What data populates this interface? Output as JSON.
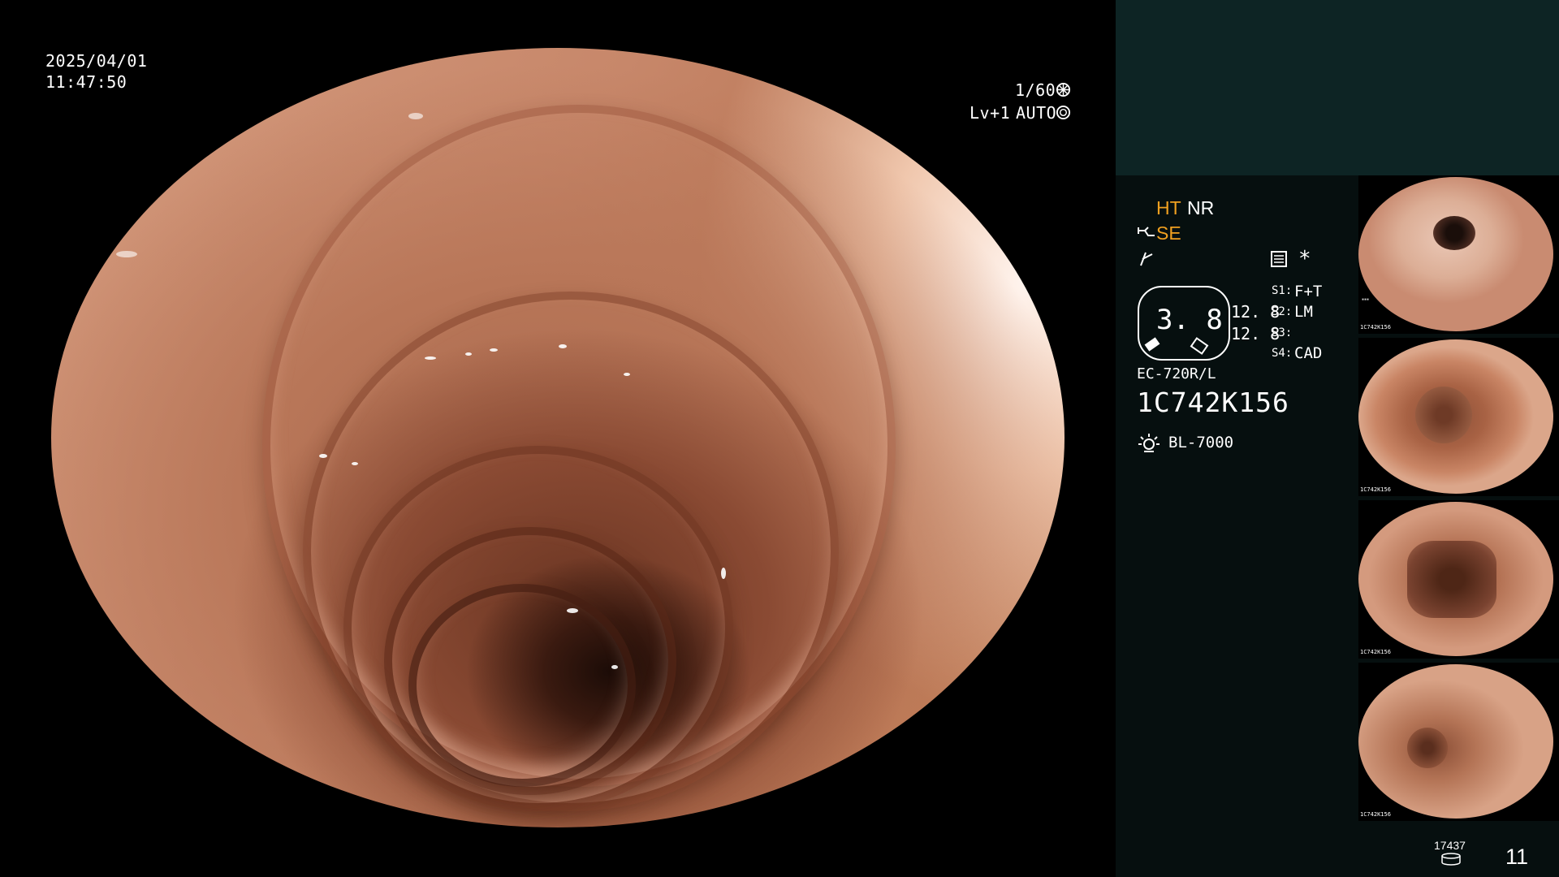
{
  "overlay": {
    "date": "2025/04/01",
    "time": "11:47:50",
    "shutter": "1/60",
    "level": "Lv+1",
    "iris": "AUTO"
  },
  "panel": {
    "ht": "HT",
    "nr": "NR",
    "se": "SE",
    "asterisk": "*",
    "gauge_value": "3. 8",
    "value_a": "12. 8",
    "value_b": "12. 8",
    "settings": [
      {
        "key": "S1:",
        "value": "F+T"
      },
      {
        "key": "S2:",
        "value": "LM"
      },
      {
        "key": "S3:",
        "value": ""
      },
      {
        "key": "S4:",
        "value": "CAD"
      }
    ],
    "scope_model": "EC-720R/L",
    "scope_serial": "1C742K156",
    "light_source": "BL-7000",
    "storage_count": "17437",
    "image_count": "11"
  },
  "thumbnails": [
    {
      "id": "1C742K156",
      "accent": "#c9856a"
    },
    {
      "id": "1C742K156",
      "accent": "#b8704e"
    },
    {
      "id": "1C742K156",
      "accent": "#bf7a5c"
    },
    {
      "id": "1C742K156",
      "accent": "#c08060"
    }
  ],
  "colors": {
    "panel_top": "#0d2424",
    "panel_bottom": "#060f0f",
    "highlight": "#f0a020"
  },
  "icons": [
    "shutter-icon",
    "iris-icon",
    "scope-icon",
    "flash-icon",
    "settings-icon",
    "light-icon",
    "storage-icon"
  ]
}
